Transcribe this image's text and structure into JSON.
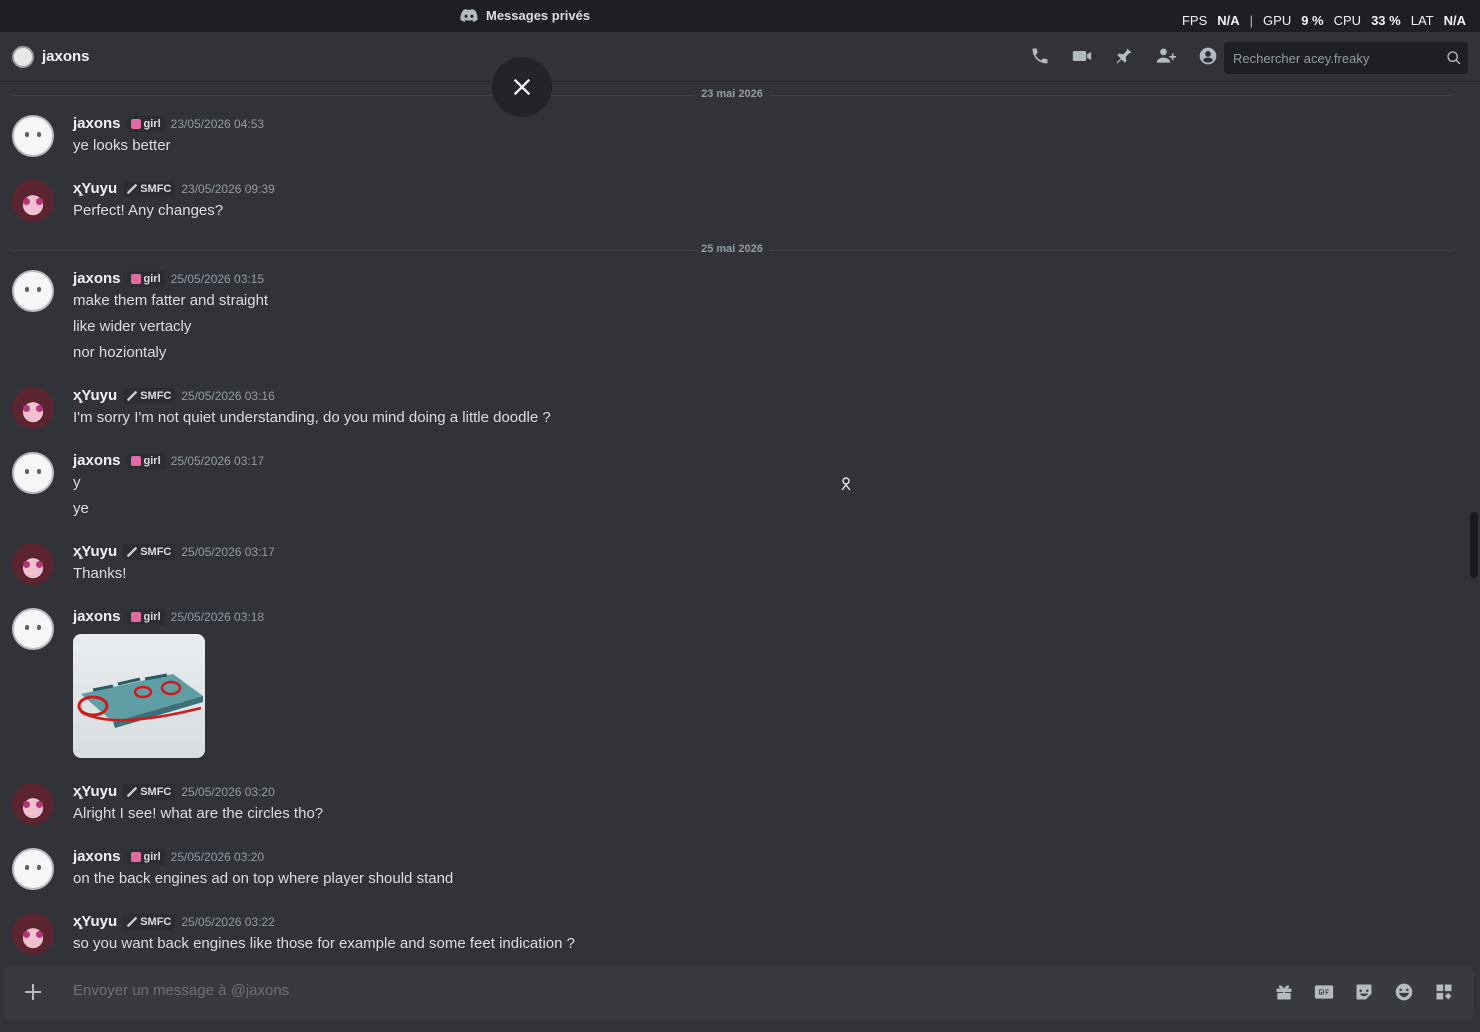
{
  "titlebar": {
    "app_title": "Messages privés",
    "fps_label": "FPS",
    "fps_value": "N/A",
    "gpu_label": "GPU",
    "gpu_value": "9 %",
    "cpu_label": "CPU",
    "cpu_value": "33 %",
    "lat_label": "LAT",
    "lat_value": "N/A"
  },
  "header": {
    "name": "jaxons",
    "search_placeholder": "Rechercher acey.freaky"
  },
  "dividers": [
    "23 mai 2026",
    "25 mai 2026"
  ],
  "messages": [
    {
      "user": "jaxons",
      "tag": "girl",
      "time": "23/05/2026 04:53",
      "lines": [
        "ye looks better"
      ]
    },
    {
      "user": "ҳ̥Yuyu",
      "tag": "SMFC",
      "time": "23/05/2026 09:39",
      "lines": [
        "Perfect! Any changes?"
      ]
    },
    {
      "user": "jaxons",
      "tag": "girl",
      "time": "25/05/2026 03:15",
      "lines": [
        "make them fatter  and straight",
        "like wider vertacly",
        "nor hoziontaly"
      ]
    },
    {
      "user": "ҳ̥Yuyu",
      "tag": "SMFC",
      "time": "25/05/2026 03:16",
      "lines": [
        "I'm sorry I'm not quiet understanding, do you mind doing a little doodle ?"
      ]
    },
    {
      "user": "jaxons",
      "tag": "girl",
      "time": "25/05/2026 03:17",
      "lines": [
        "y",
        "ye"
      ]
    },
    {
      "user": "ҳ̥Yuyu",
      "tag": "SMFC",
      "time": "25/05/2026 03:17",
      "lines": [
        "Thanks!"
      ]
    },
    {
      "user": "jaxons",
      "tag": "girl",
      "time": "25/05/2026 03:18",
      "lines": []
    },
    {
      "user": "ҳ̥Yuyu",
      "tag": "SMFC",
      "time": "25/05/2026 03:20",
      "lines": [
        "Alright I see! what are the circles tho?"
      ]
    },
    {
      "user": "jaxons",
      "tag": "girl",
      "time": "25/05/2026 03:20",
      "lines": [
        "on the back engines ad on top where player should stand"
      ]
    },
    {
      "user": "ҳ̥Yuyu",
      "tag": "SMFC",
      "time": "25/05/2026 03:22",
      "lines": [
        "so you want back engines like those for example and some feet indication ?"
      ]
    }
  ],
  "composer": {
    "placeholder": "Envoyer un message à @jaxons"
  },
  "icons": {
    "call": "phone-icon",
    "video": "video-icon",
    "pin": "pin-icon",
    "add_friend": "add-member-icon",
    "profile": "profile-icon",
    "gift": "gift-icon",
    "gif": "gif-icon",
    "sticker": "sticker-icon",
    "emoji": "emoji-icon",
    "apps": "apps-icon"
  },
  "colors": {
    "background": "#313338",
    "titlebar": "#1e1f22",
    "composer": "#383a40",
    "text": "#dbdee1",
    "muted": "#949ba4",
    "girl_tag_icon": "#e26aa5"
  }
}
